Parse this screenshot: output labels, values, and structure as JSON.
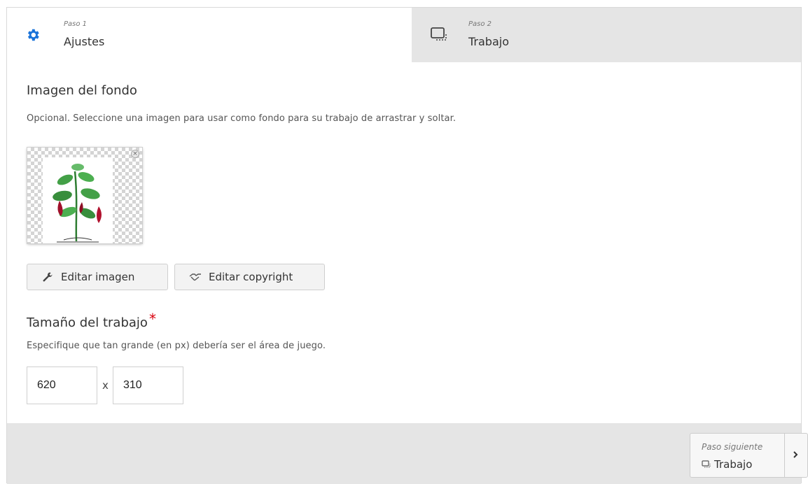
{
  "tabs": [
    {
      "step": "Paso 1",
      "title": "Ajustes",
      "icon": "gear-icon",
      "active": true
    },
    {
      "step": "Paso 2",
      "title": "Trabajo",
      "icon": "dropzone-icon",
      "active": false
    }
  ],
  "background_image": {
    "title": "Imagen del fondo",
    "description": "Opcional. Seleccione una imagen para usar como fondo para su trabajo de arrastrar y soltar.",
    "remove_label": "×",
    "edit_image_label": "Editar imagen",
    "edit_copyright_label": "Editar copyright"
  },
  "task_size": {
    "title": "Tamaño del trabajo",
    "required_mark": "*",
    "description": "Especifique que tan grande (en px) debería ser el área de juego.",
    "width_value": "620",
    "separator": "x",
    "height_value": "310"
  },
  "footer": {
    "next_step_label": "Paso siguiente",
    "next_title": "Trabajo"
  },
  "colors": {
    "accent": "#1a73d9",
    "required": "#d9000d",
    "inactive_tab": "#e5e5e5"
  }
}
